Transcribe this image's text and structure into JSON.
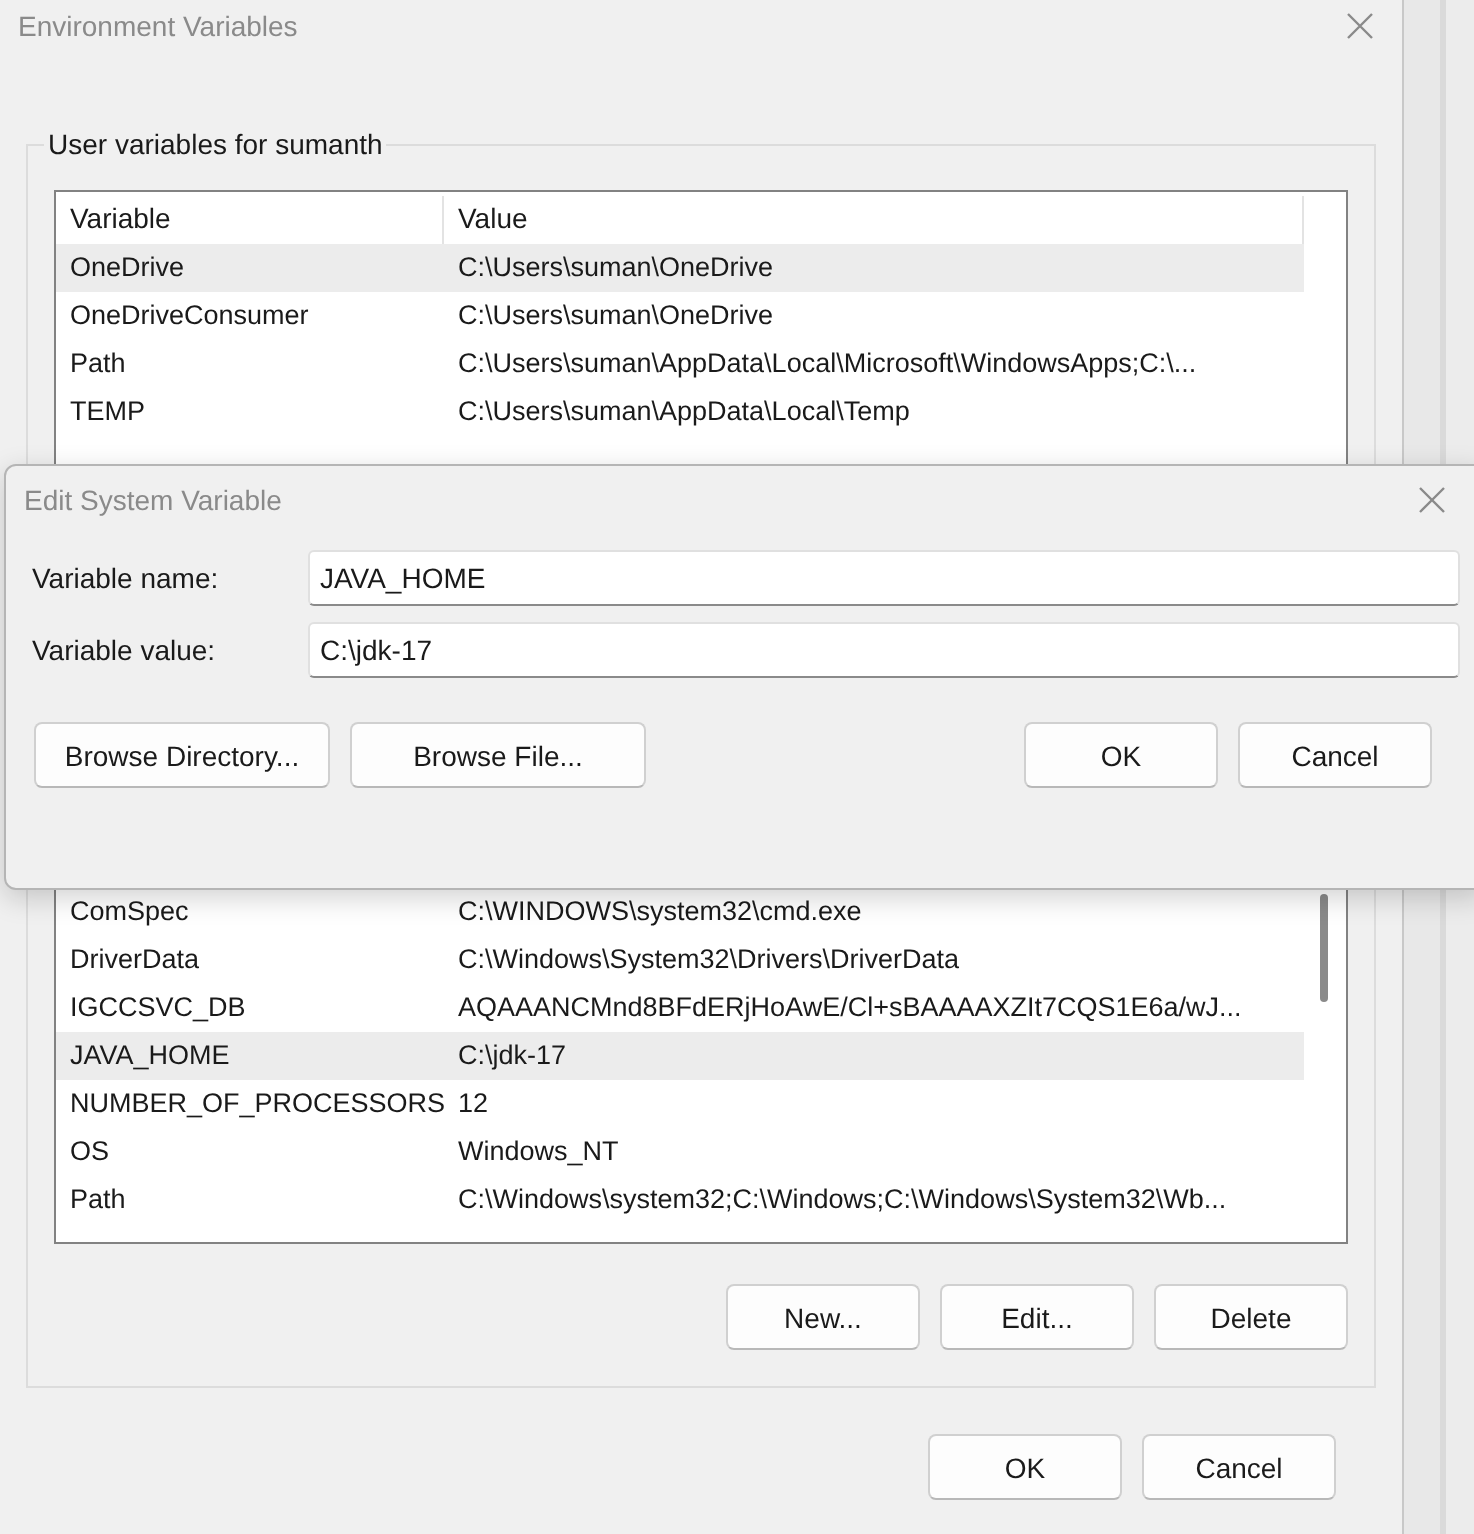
{
  "window": {
    "title": "Environment Variables"
  },
  "user_variables": {
    "label": "User variables for sumanth",
    "columns": [
      "Variable",
      "Value"
    ],
    "rows": [
      {
        "variable": "OneDrive",
        "value": "C:\\Users\\suman\\OneDrive",
        "selected": true
      },
      {
        "variable": "OneDriveConsumer",
        "value": "C:\\Users\\suman\\OneDrive",
        "selected": false
      },
      {
        "variable": "Path",
        "value": "C:\\Users\\suman\\AppData\\Local\\Microsoft\\WindowsApps;C:\\...",
        "selected": false
      },
      {
        "variable": "TEMP",
        "value": "C:\\Users\\suman\\AppData\\Local\\Temp",
        "selected": false
      }
    ]
  },
  "system_variables": {
    "rows": [
      {
        "variable": "ComSpec",
        "value": "C:\\WINDOWS\\system32\\cmd.exe",
        "selected": false
      },
      {
        "variable": "DriverData",
        "value": "C:\\Windows\\System32\\Drivers\\DriverData",
        "selected": false
      },
      {
        "variable": "IGCCSVC_DB",
        "value": "AQAAANCMnd8BFdERjHoAwE/Cl+sBAAAAXZIt7CQS1E6a/wJ...",
        "selected": false
      },
      {
        "variable": "JAVA_HOME",
        "value": "C:\\jdk-17",
        "selected": true
      },
      {
        "variable": "NUMBER_OF_PROCESSORS",
        "value": "12",
        "selected": false
      },
      {
        "variable": "OS",
        "value": "Windows_NT",
        "selected": false
      },
      {
        "variable": "Path",
        "value": "C:\\Windows\\system32;C:\\Windows;C:\\Windows\\System32\\Wb...",
        "selected": false
      }
    ],
    "buttons": [
      "New...",
      "Edit...",
      "Delete"
    ]
  },
  "buttons": [
    "OK",
    "Cancel"
  ],
  "dialog": {
    "title": "Edit System Variable",
    "fields": [
      {
        "label": "Variable name:",
        "value": "JAVA_HOME"
      },
      {
        "label": "Variable value:",
        "value": "C:\\jdk-17"
      }
    ],
    "browse_buttons": [
      "Browse Directory...",
      "Browse File..."
    ],
    "buttons": [
      "OK",
      "Cancel"
    ]
  }
}
